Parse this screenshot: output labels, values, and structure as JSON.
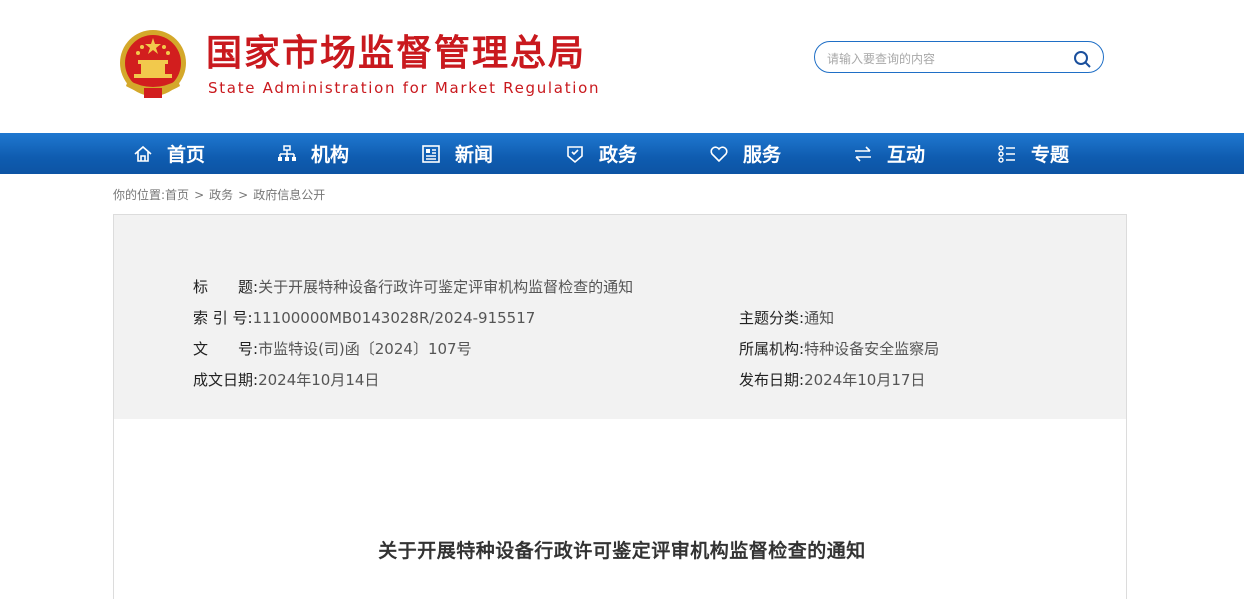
{
  "header": {
    "title": "国家市场监督管理总局",
    "subtitle": "State Administration for Market Regulation",
    "search_placeholder": "请输入要查询的内容"
  },
  "nav": [
    {
      "label": "首页",
      "icon": "home-icon"
    },
    {
      "label": "机构",
      "icon": "org-chart-icon"
    },
    {
      "label": "新闻",
      "icon": "newspaper-icon"
    },
    {
      "label": "政务",
      "icon": "government-badge-icon"
    },
    {
      "label": "服务",
      "icon": "heart-icon"
    },
    {
      "label": "互动",
      "icon": "exchange-arrows-icon"
    },
    {
      "label": "专题",
      "icon": "topics-list-icon"
    }
  ],
  "breadcrumb": {
    "prefix": "你的位置:",
    "items": [
      "首页",
      "政务",
      "政府信息公开"
    ],
    "separator": ">"
  },
  "meta": {
    "title_label": "标　　题:",
    "title_value": "关于开展特种设备行政许可鉴定评审机构监督检查的通知",
    "index_label": "索 引 号:",
    "index_value": "11100000MB0143028R/2024-915517",
    "docno_label": "文　　号:",
    "docno_value": "市监特设(司)函〔2024〕107号",
    "date_label": "成文日期:",
    "date_value": "2024年10月14日",
    "category_label": "主题分类:",
    "category_value": "通知",
    "org_label": "所属机构:",
    "org_value": "特种设备安全监察局",
    "pubdate_label": "发布日期:",
    "pubdate_value": "2024年10月17日"
  },
  "document": {
    "title": "关于开展特种设备行政许可鉴定评审机构监督检查的通知"
  },
  "colors": {
    "brand_red": "#c9191e",
    "nav_blue": "#1565c0",
    "search_border": "#1f6fc6"
  }
}
